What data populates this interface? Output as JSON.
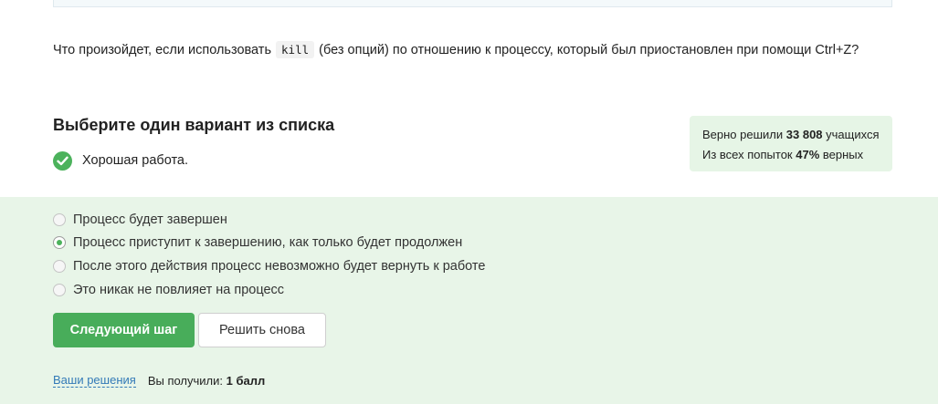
{
  "question": {
    "before_code": "Что произойдет, если использовать ",
    "code": "kill",
    "after_code": " (без опций) по отношению к процессу, который был приостановлен при помощи Ctrl+Z?"
  },
  "choose": {
    "title": "Выберите один вариант из списка",
    "feedback": "Хорошая работа.",
    "feedback_icon": "check-circle-icon"
  },
  "stats": {
    "solved_prefix": "Верно решили ",
    "solved_count": "33 808",
    "solved_suffix": " учащихся",
    "attempts_prefix": "Из всех попыток ",
    "attempts_percent": "47%",
    "attempts_suffix": " верных"
  },
  "options": [
    {
      "label": "Процесс будет завершен",
      "selected": false
    },
    {
      "label": "Процесс приступит к завершению, как только будет продолжен",
      "selected": true
    },
    {
      "label": "После этого действия процесс невозможно будет вернуть к работе",
      "selected": false
    },
    {
      "label": "Это никак не повлияет на процесс",
      "selected": false
    }
  ],
  "buttons": {
    "next": "Следующий шаг",
    "retry": "Решить снова"
  },
  "footer": {
    "solutions_link": "Ваши решения",
    "score_prefix": "Вы получили: ",
    "score_value": "1 балл"
  },
  "colors": {
    "accent_green": "#48ad5a",
    "answer_bg": "#e8f5e8",
    "stats_bg": "#e6f5e6",
    "link": "#337ab7"
  }
}
